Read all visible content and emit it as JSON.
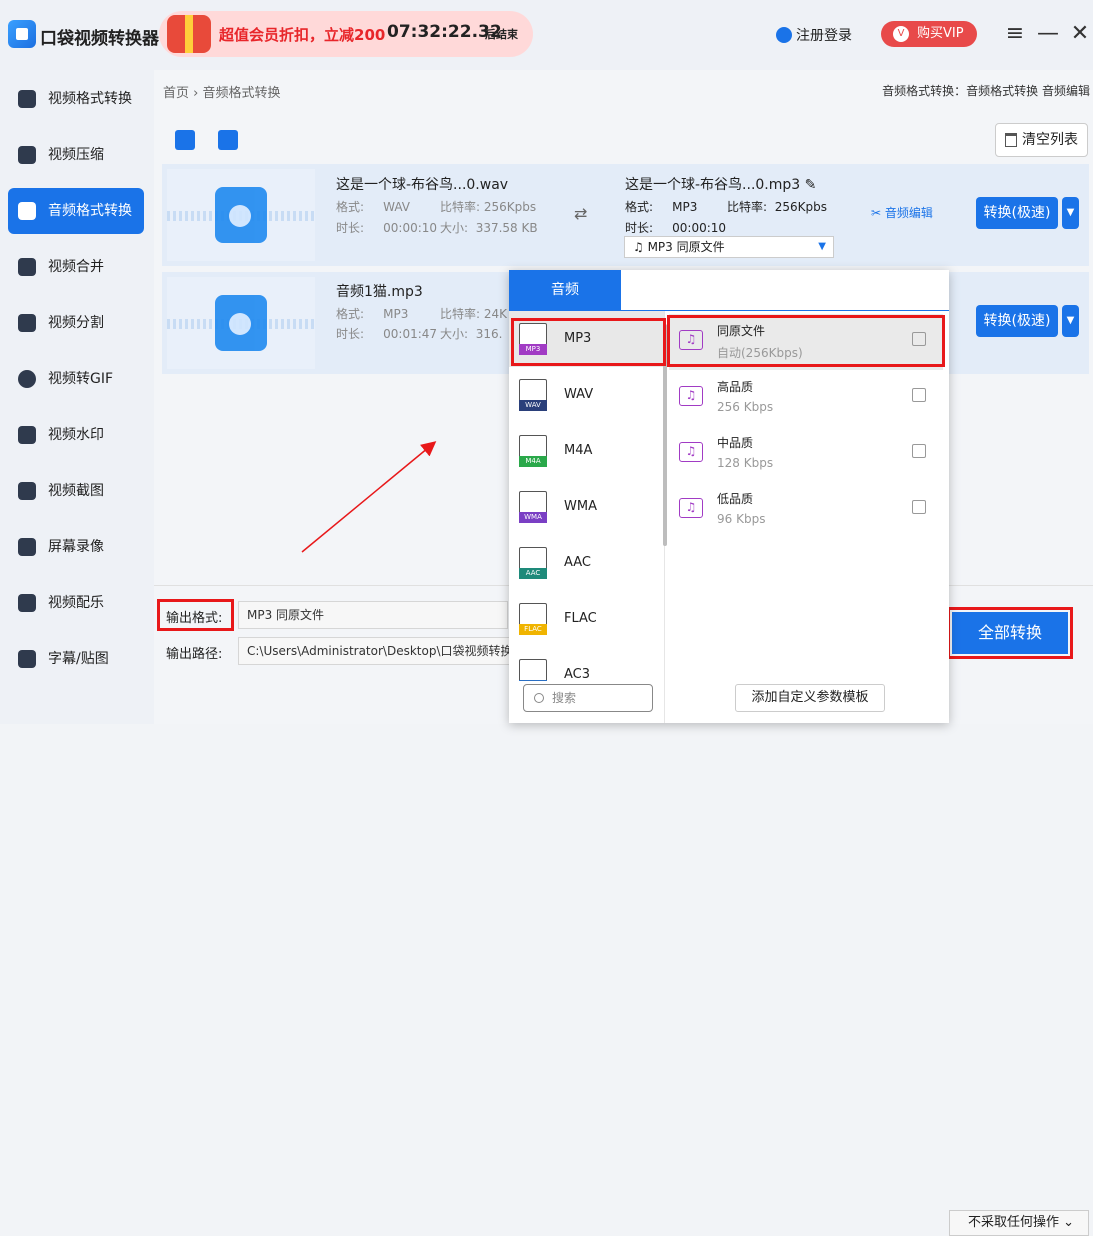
{
  "app": {
    "title": "口袋视频转换器",
    "promo_text": "超值会员折扣，立减200",
    "promo_time": "07:32:22.32",
    "promo_end": "后结束",
    "login": "注册登录",
    "vip": "购买VIP"
  },
  "sidebar": {
    "items": [
      "视频格式转换",
      "视频压缩",
      "音频格式转换",
      "视频合并",
      "视频分割",
      "视频转GIF",
      "视频水印",
      "视频截图",
      "屏幕录像",
      "视频配乐",
      "字幕/贴图"
    ],
    "active_index": 2
  },
  "breadcrumb": {
    "home": "首页",
    "current": "音频格式转换",
    "right": "音频格式转换：音频格式转换 音频编辑"
  },
  "toolbar": {
    "clear": "清空列表"
  },
  "files": [
    {
      "name": "这是一个球-布谷鸟...0.wav",
      "format_label": "格式:",
      "format": "WAV",
      "bitrate_label": "比特率:",
      "bitrate": "256Kpbs",
      "duration_label": "时长:",
      "duration": "00:00:10",
      "size_label": "大小:",
      "size": "337.58 KB",
      "out_name": "这是一个球-布谷鸟...0.mp3",
      "out_format": "MP3",
      "out_bitrate": "256Kpbs",
      "out_duration": "00:00:10",
      "out_select": "MP3  同原文件",
      "edit": "音频编辑",
      "convert": "转换(极速)"
    },
    {
      "name": "音频1猫.mp3",
      "format_label": "格式:",
      "format": "MP3",
      "bitrate_label": "比特率:",
      "bitrate": "24K",
      "duration_label": "时长:",
      "duration": "00:01:47",
      "size_label": "大小:",
      "size": "316.",
      "convert": "转换(极速)"
    }
  ],
  "bottom": {
    "format_label": "输出格式:",
    "format_value": "MP3  同原文件",
    "path_label": "输出路径:",
    "path_value": "C:\\Users\\Administrator\\Desktop\\口袋视频转换",
    "convert_all": "全部转换",
    "after": "不采取任何操作"
  },
  "popup": {
    "tab": "音频",
    "formats": [
      {
        "name": "MP3",
        "color": "#a13bc4"
      },
      {
        "name": "WAV",
        "color": "#2a3f7a"
      },
      {
        "name": "M4A",
        "color": "#2aa84a"
      },
      {
        "name": "WMA",
        "color": "#7a3fc4"
      },
      {
        "name": "AAC",
        "color": "#1e8a7a"
      },
      {
        "name": "FLAC",
        "color": "#f0b400"
      },
      {
        "name": "AC3",
        "color": "#2a6fc4"
      }
    ],
    "qualities": [
      {
        "name": "同原文件",
        "sub": "自动(256Kbps)"
      },
      {
        "name": "高品质",
        "sub": "256 Kbps"
      },
      {
        "name": "中品质",
        "sub": "128 Kbps"
      },
      {
        "name": "低品质",
        "sub": "96 Kbps"
      }
    ],
    "search_placeholder": "搜索",
    "add_template": "添加自定义参数模板"
  },
  "colors": {
    "accent": "#1a73e8",
    "highlight": "#e8181a"
  }
}
